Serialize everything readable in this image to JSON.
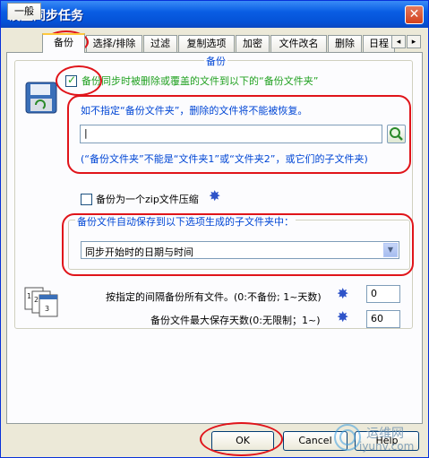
{
  "window": {
    "title": "设置同步任务",
    "close_label": "✕"
  },
  "tabs": [
    {
      "label": "一般"
    },
    {
      "label": "备份"
    },
    {
      "label": "选择/排除"
    },
    {
      "label": "过滤"
    },
    {
      "label": "复制选项"
    },
    {
      "label": "加密"
    },
    {
      "label": "文件改名"
    },
    {
      "label": "删除"
    },
    {
      "label": "日程"
    }
  ],
  "tab_arrows": {
    "left": "◂",
    "right": "▸"
  },
  "backup_group": {
    "caption": "备份",
    "enable_checkbox": {
      "checked": true,
      "label": "备份同步时被删除或覆盖的文件到以下的“备份文件夹”"
    },
    "hint": "如不指定“备份文件夹”，删除的文件将不能被恢复。",
    "folder_input": {
      "value": "|",
      "placeholder": ""
    },
    "note": "(“备份文件夹”不能是“文件夹1”或“文件夹2”，或它们的子文件夹)",
    "zip_checkbox": {
      "checked": false,
      "label": "备份为一个zip文件压缩"
    },
    "subfolder_group_caption": "备份文件自动保存到以下选项生成的子文件夹中：",
    "subfolder_select_value": "同步开始时的日期与时间"
  },
  "interval": {
    "label": "按指定的间隔备份所有文件。(0:不备份; 1~天数)",
    "value": "0"
  },
  "max_days": {
    "label": "备份文件最大保存天数(0:无限制；1~)",
    "value": "60"
  },
  "buttons": {
    "ok": "OK",
    "cancel": "Cancel",
    "help": "Help"
  },
  "watermark": {
    "text1": "运维网",
    "text2": "iyunv.com"
  },
  "colors": {
    "accent": "#0046d5",
    "annotation_red": "#e0141a",
    "title_bar": "#0451d6"
  }
}
